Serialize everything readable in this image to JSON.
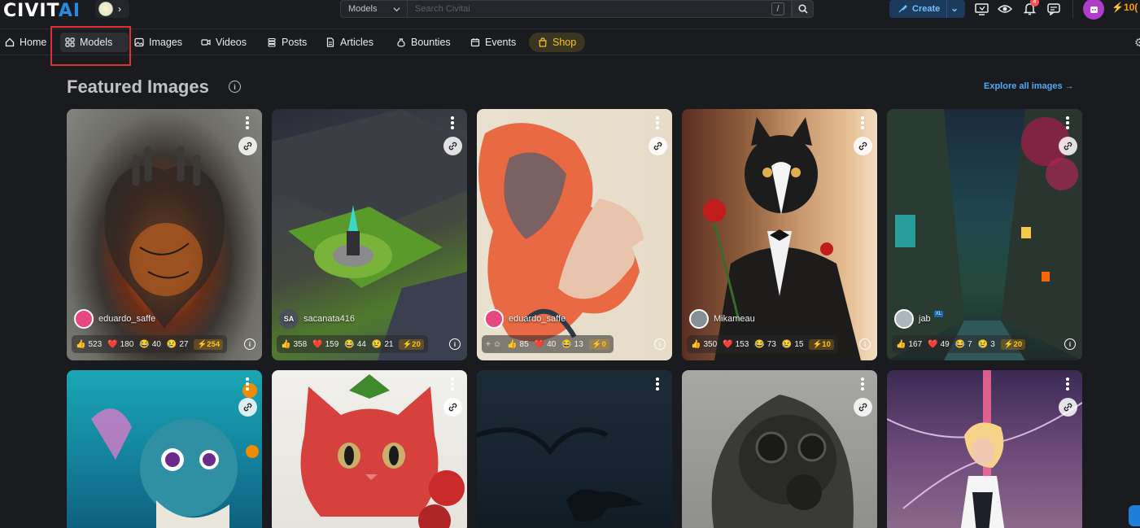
{
  "header": {
    "logo_main": "CIVIT",
    "logo_accent": "AI",
    "search_type": "Models",
    "search_placeholder": "Search Civitai",
    "search_shortcut": "/",
    "create_label": "Create",
    "notification_count": "4",
    "buzz_amount": "10("
  },
  "nav": {
    "items": [
      {
        "label": "Home",
        "icon": "home-icon"
      },
      {
        "label": "Models",
        "icon": "grid-icon"
      },
      {
        "label": "Images",
        "icon": "image-icon"
      },
      {
        "label": "Videos",
        "icon": "video-icon"
      },
      {
        "label": "Posts",
        "icon": "stack-icon"
      },
      {
        "label": "Articles",
        "icon": "article-icon"
      },
      {
        "label": "Bounties",
        "icon": "moneybag-icon"
      },
      {
        "label": "Events",
        "icon": "calendar-icon"
      },
      {
        "label": "Shop",
        "icon": "shopping-bag-icon"
      }
    ],
    "active": "Models"
  },
  "main": {
    "section_title": "Featured Images",
    "explore_label": "Explore all images",
    "cards": [
      {
        "user": "eduardo_saffe",
        "avatar_text": "",
        "avatar_color": "#e64980",
        "likes": "523",
        "hearts": "180",
        "laughs": "40",
        "cries": "27",
        "buzz": "254",
        "show_add": false
      },
      {
        "user": "sacanata416",
        "avatar_text": "SA",
        "avatar_color": "#495057",
        "likes": "358",
        "hearts": "159",
        "laughs": "44",
        "cries": "21",
        "buzz": "20",
        "show_add": false
      },
      {
        "user": "eduardo_saffe",
        "avatar_text": "",
        "avatar_color": "#e64980",
        "likes": "85",
        "hearts": "40",
        "laughs": "13",
        "cries": "",
        "buzz": "0",
        "show_add": true
      },
      {
        "user": "Mikameau",
        "avatar_text": "",
        "avatar_color": "#868e96",
        "likes": "350",
        "hearts": "153",
        "laughs": "73",
        "cries": "15",
        "buzz": "10",
        "show_add": false
      },
      {
        "user": "jab",
        "avatar_text": "",
        "avatar_color": "#adb5bd",
        "verified": "XL",
        "likes": "167",
        "hearts": "49",
        "laughs": "7",
        "cries": "3",
        "buzz": "20",
        "show_add": false
      }
    ]
  },
  "colors": {
    "background": "#1a1b1e",
    "accent_blue": "#228be6",
    "buzz_yellow": "#fcc419",
    "highlight_red": "#e03131"
  }
}
